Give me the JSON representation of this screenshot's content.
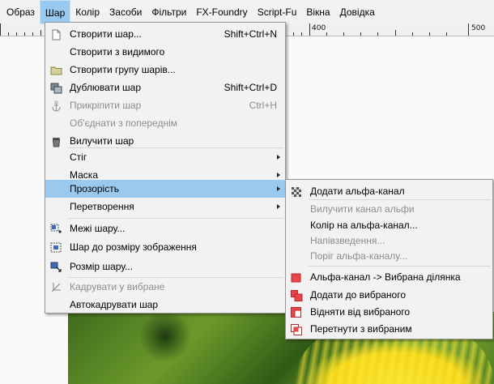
{
  "menubar": {
    "items": [
      "Образ",
      "Шар",
      "Колір",
      "Засоби",
      "Фільтри",
      "FX-Foundry",
      "Script-Fu",
      "Вікна",
      "Довідка"
    ],
    "active_index": 1
  },
  "ruler": {
    "labels": [
      "400",
      "500"
    ]
  },
  "layer_menu": {
    "items": [
      {
        "label": "Створити шар...",
        "shortcut": "Shift+Ctrl+N",
        "icon": "new-layer-icon",
        "enabled": true
      },
      {
        "label": "Створити з видимого",
        "shortcut": "",
        "icon": "",
        "enabled": true
      },
      {
        "label": "Створити групу шарів...",
        "shortcut": "",
        "icon": "folder-icon",
        "enabled": true
      },
      {
        "label": "Дублювати шар",
        "shortcut": "Shift+Ctrl+D",
        "icon": "duplicate-layer-icon",
        "enabled": true
      },
      {
        "label": "Прикріпити шар",
        "shortcut": "Ctrl+H",
        "icon": "anchor-icon",
        "enabled": false
      },
      {
        "label": "Об'єднати з попереднім",
        "shortcut": "",
        "icon": "",
        "enabled": false
      },
      {
        "label": "Вилучити шар",
        "shortcut": "",
        "icon": "trash-icon",
        "enabled": true
      },
      {
        "label": "Стіг",
        "submenu": true,
        "enabled": true
      },
      {
        "label": "Маска",
        "submenu": true,
        "enabled": true
      },
      {
        "label": "Прозорість",
        "submenu": true,
        "enabled": true,
        "highlighted": true
      },
      {
        "label": "Перетворення",
        "submenu": true,
        "enabled": true
      },
      {
        "label": "Межі шару...",
        "shortcut": "",
        "icon": "layer-boundary-icon",
        "enabled": true
      },
      {
        "label": "Шар до розміру зображення",
        "shortcut": "",
        "icon": "layer-to-image-size-icon",
        "enabled": true
      },
      {
        "label": "Розмір шару...",
        "shortcut": "",
        "icon": "scale-layer-icon",
        "enabled": true
      },
      {
        "label": "Кадрувати у вибране",
        "shortcut": "",
        "icon": "crop-icon",
        "enabled": false
      },
      {
        "label": "Автокадрувати шар",
        "shortcut": "",
        "icon": "",
        "enabled": true
      }
    ]
  },
  "transparency_menu": {
    "items": [
      {
        "label": "Додати альфа-канал",
        "icon": "add-alpha-icon",
        "enabled": true
      },
      {
        "label": "Вилучити канал альфи",
        "icon": "",
        "enabled": false
      },
      {
        "label": "Колір на альфа-канал...",
        "icon": "",
        "enabled": true
      },
      {
        "label": "Напівзведення...",
        "icon": "",
        "enabled": false
      },
      {
        "label": "Поріг альфа-каналу...",
        "icon": "",
        "enabled": false
      },
      {
        "label": "Альфа-канал -> Вибрана ділянка",
        "icon": "alpha-to-selection-icon",
        "enabled": true
      },
      {
        "label": "Додати до вибраного",
        "icon": "add-to-selection-icon",
        "enabled": true
      },
      {
        "label": "Відняти від вибраного",
        "icon": "subtract-from-selection-icon",
        "enabled": true
      },
      {
        "label": "Перетнути з вибраним",
        "icon": "intersect-selection-icon",
        "enabled": true
      }
    ]
  },
  "colors": {
    "highlight": "#99c9ef",
    "menu_bg": "#f2f2f2",
    "disabled_text": "#8d8d8d",
    "selection_red": "#e8474a"
  }
}
